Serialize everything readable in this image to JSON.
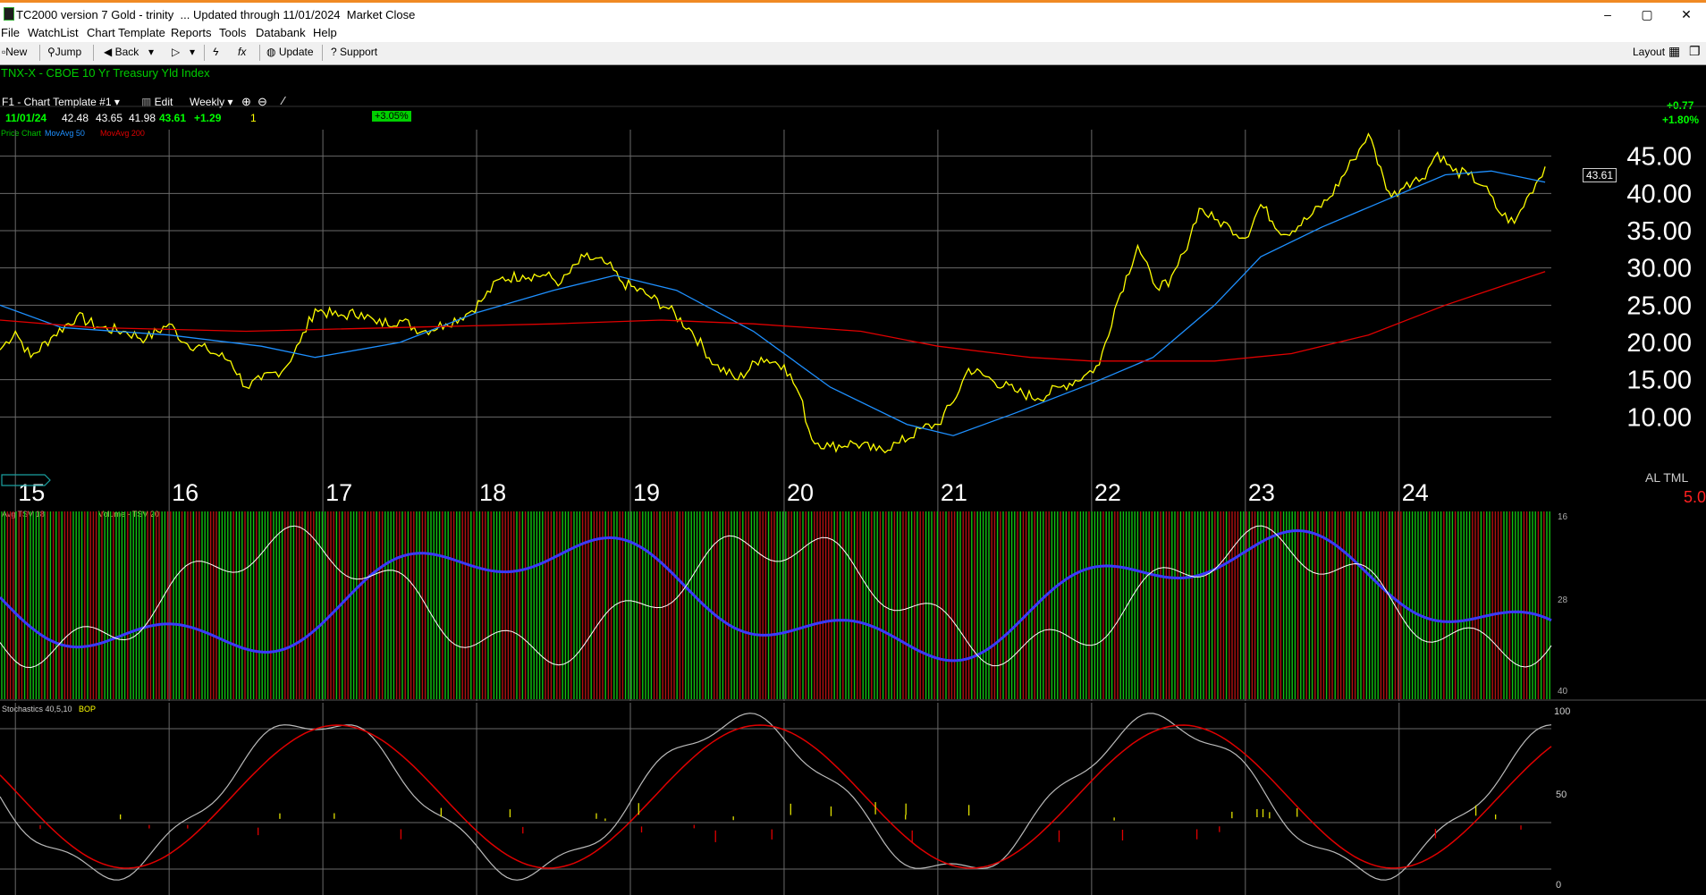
{
  "window": {
    "title": "TC2000 version 7 Gold - trinity  ... Updated through 11/01/2024  Market Close",
    "minimize": "–",
    "maximize": "▢",
    "close": "✕"
  },
  "menu": [
    "File",
    "WatchList",
    "Chart Template",
    "Reports",
    "Tools",
    "Databank",
    "Help"
  ],
  "toolbar": {
    "new": "New",
    "jump": "Jump",
    "back": "Back",
    "update": "Update",
    "support": "Support",
    "layout": "Layout"
  },
  "chart": {
    "symbol_title": "TNX-X - CBOE 10 Yr Treasury Yld Index",
    "template": "F1 - Chart Template #1",
    "edit": "Edit",
    "period": "Weekly",
    "quote": {
      "date": "11/01/24",
      "open": "42.48",
      "high": "43.65",
      "low": "41.98",
      "close": "43.61",
      "change": "+1.29",
      "count": "1",
      "pct_badge": "+3.05%"
    },
    "net_change": "+0.77",
    "net_change_pct": "+1.80%",
    "price_legend": {
      "price": "Price Chart",
      "ma50": "MovAvg 50",
      "ma200": "MovAvg 200"
    },
    "last_price_tag": "43.61",
    "corner_label": "AL TML",
    "corner_value": "5.0",
    "colors": {
      "price": "#ffff00",
      "ma50": "#1e90ff",
      "ma200": "#e00000",
      "grid": "#6a6a6a",
      "green": "#00ff00",
      "bg": "#000000"
    }
  },
  "indicator1": {
    "labels": [
      "Avg TSV 18",
      "Volume - TSV 20"
    ],
    "scale": [
      "16",
      "28",
      "40"
    ]
  },
  "indicator2": {
    "labels": [
      "Stochastics 40,5,10",
      "BOP"
    ],
    "scale": [
      "100",
      "50",
      "0"
    ]
  },
  "chart_data": {
    "type": "line",
    "title": "TNX-X - CBOE 10 Yr Treasury Yld Index",
    "x_tick_labels": [
      "15",
      "16",
      "17",
      "18",
      "19",
      "20",
      "21",
      "22",
      "23",
      "24"
    ],
    "y_tick_labels": [
      "45.00",
      "40.00",
      "35.00",
      "30.00",
      "25.00",
      "20.00",
      "15.00",
      "10.00"
    ],
    "ylim": [
      5,
      50
    ],
    "x_domain": [
      2014.9,
      2024.99
    ],
    "series": [
      {
        "name": "Price Chart",
        "color": "#ffff00",
        "points": [
          [
            2014.9,
            19.0
          ],
          [
            2015.0,
            21.5
          ],
          [
            2015.1,
            18.0
          ],
          [
            2015.25,
            21.0
          ],
          [
            2015.4,
            23.5
          ],
          [
            2015.55,
            22.0
          ],
          [
            2015.7,
            21.5
          ],
          [
            2015.85,
            20.5
          ],
          [
            2016.0,
            22.5
          ],
          [
            2016.1,
            20.0
          ],
          [
            2016.25,
            19.0
          ],
          [
            2016.4,
            17.5
          ],
          [
            2016.5,
            14.0
          ],
          [
            2016.6,
            15.0
          ],
          [
            2016.75,
            16.5
          ],
          [
            2016.85,
            20.0
          ],
          [
            2016.95,
            24.5
          ],
          [
            2017.1,
            23.5
          ],
          [
            2017.25,
            24.0
          ],
          [
            2017.35,
            22.5
          ],
          [
            2017.5,
            23.0
          ],
          [
            2017.65,
            21.5
          ],
          [
            2017.8,
            22.5
          ],
          [
            2017.95,
            24.0
          ],
          [
            2018.05,
            26.0
          ],
          [
            2018.15,
            28.5
          ],
          [
            2018.3,
            29.0
          ],
          [
            2018.45,
            29.0
          ],
          [
            2018.55,
            28.0
          ],
          [
            2018.7,
            31.5
          ],
          [
            2018.85,
            30.5
          ],
          [
            2018.95,
            28.0
          ],
          [
            2019.1,
            26.5
          ],
          [
            2019.25,
            24.5
          ],
          [
            2019.4,
            21.5
          ],
          [
            2019.55,
            17.0
          ],
          [
            2019.7,
            15.0
          ],
          [
            2019.85,
            18.0
          ],
          [
            2020.0,
            17.0
          ],
          [
            2020.1,
            13.0
          ],
          [
            2020.18,
            7.0
          ],
          [
            2020.3,
            6.0
          ],
          [
            2020.45,
            6.5
          ],
          [
            2020.6,
            5.5
          ],
          [
            2020.75,
            6.5
          ],
          [
            2020.9,
            8.5
          ],
          [
            2021.0,
            9.0
          ],
          [
            2021.1,
            12.0
          ],
          [
            2021.2,
            16.5
          ],
          [
            2021.35,
            15.0
          ],
          [
            2021.5,
            13.5
          ],
          [
            2021.65,
            12.5
          ],
          [
            2021.8,
            14.0
          ],
          [
            2021.95,
            15.5
          ],
          [
            2022.05,
            17.0
          ],
          [
            2022.15,
            24.5
          ],
          [
            2022.3,
            33.0
          ],
          [
            2022.4,
            28.0
          ],
          [
            2022.5,
            27.5
          ],
          [
            2022.6,
            32.0
          ],
          [
            2022.7,
            38.0
          ],
          [
            2022.8,
            36.5
          ],
          [
            2022.9,
            35.5
          ],
          [
            2023.0,
            34.0
          ],
          [
            2023.1,
            38.5
          ],
          [
            2023.25,
            34.5
          ],
          [
            2023.4,
            36.5
          ],
          [
            2023.55,
            39.5
          ],
          [
            2023.7,
            44.5
          ],
          [
            2023.8,
            48.0
          ],
          [
            2023.9,
            42.0
          ],
          [
            2023.95,
            39.5
          ],
          [
            2024.05,
            41.5
          ],
          [
            2024.15,
            42.0
          ],
          [
            2024.25,
            45.5
          ],
          [
            2024.35,
            43.0
          ],
          [
            2024.45,
            42.5
          ],
          [
            2024.55,
            41.0
          ],
          [
            2024.65,
            37.5
          ],
          [
            2024.75,
            36.0
          ],
          [
            2024.85,
            40.0
          ],
          [
            2024.95,
            43.61
          ]
        ]
      },
      {
        "name": "MovAvg 50",
        "color": "#1e90ff",
        "points": [
          [
            2014.9,
            25.0
          ],
          [
            2015.3,
            22.0
          ],
          [
            2016.0,
            21.0
          ],
          [
            2016.6,
            19.5
          ],
          [
            2016.95,
            18.0
          ],
          [
            2017.5,
            20.0
          ],
          [
            2018.0,
            24.0
          ],
          [
            2018.5,
            27.0
          ],
          [
            2018.9,
            29.0
          ],
          [
            2019.3,
            27.0
          ],
          [
            2019.8,
            21.5
          ],
          [
            2020.3,
            14.0
          ],
          [
            2020.8,
            9.0
          ],
          [
            2021.1,
            7.5
          ],
          [
            2021.5,
            10.5
          ],
          [
            2022.0,
            14.5
          ],
          [
            2022.4,
            18.0
          ],
          [
            2022.8,
            25.0
          ],
          [
            2023.1,
            31.5
          ],
          [
            2023.5,
            35.5
          ],
          [
            2023.9,
            39.0
          ],
          [
            2024.3,
            42.5
          ],
          [
            2024.6,
            43.0
          ],
          [
            2024.95,
            41.5
          ]
        ]
      },
      {
        "name": "MovAvg 200",
        "color": "#e00000",
        "points": [
          [
            2014.9,
            23.0
          ],
          [
            2015.5,
            22.0
          ],
          [
            2016.5,
            21.5
          ],
          [
            2017.5,
            22.0
          ],
          [
            2018.5,
            22.5
          ],
          [
            2019.2,
            23.0
          ],
          [
            2019.8,
            22.5
          ],
          [
            2020.5,
            21.5
          ],
          [
            2021.0,
            19.5
          ],
          [
            2021.6,
            18.0
          ],
          [
            2022.0,
            17.5
          ],
          [
            2022.8,
            17.5
          ],
          [
            2023.3,
            18.5
          ],
          [
            2023.8,
            21.0
          ],
          [
            2024.3,
            25.0
          ],
          [
            2024.95,
            29.5
          ]
        ]
      }
    ]
  }
}
